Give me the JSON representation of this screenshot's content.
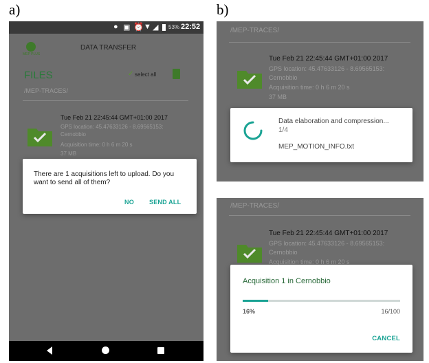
{
  "panel_labels": {
    "a": "a)",
    "b": "b)"
  },
  "status_bar": {
    "battery": "53%",
    "time": "22:52"
  },
  "header": {
    "title": "DATA TRANSFER",
    "logo_text": "MEP PLUS"
  },
  "files": {
    "title": "FILES",
    "select_all": "select all",
    "path": "/MEP-TRACES/"
  },
  "trace": {
    "date": "Tue Feb 21 22:45:44 GMT+01:00 2017",
    "gps": "GPS location: 45.47633126 - 8.69565153:",
    "place": "Cernobbio",
    "acq_time": "Acquisition time: 0 h 6 m 20 s",
    "size": "37 MB"
  },
  "upload_dialog": {
    "message": "There are 1 acquisitions left to upload. Do you want to send all of them?",
    "no_label": "NO",
    "send_all_label": "SEND ALL"
  },
  "processing_dialog": {
    "status": "Data elaboration and compression...",
    "step": "1/4",
    "filename": "MEP_MOTION_INFO.txt"
  },
  "progress_dialog": {
    "title": "Acquisition 1 in Cernobbio",
    "percent_label": "16%",
    "count_label": "16/100",
    "progress_fraction": 0.16,
    "cancel_label": "CANCEL"
  },
  "colors": {
    "accent": "#1aa394",
    "folder": "#4f8a2a",
    "dim_bg": "#6d6d6d",
    "status_bar": "#3a3a3a",
    "nav_bar": "#000000"
  }
}
